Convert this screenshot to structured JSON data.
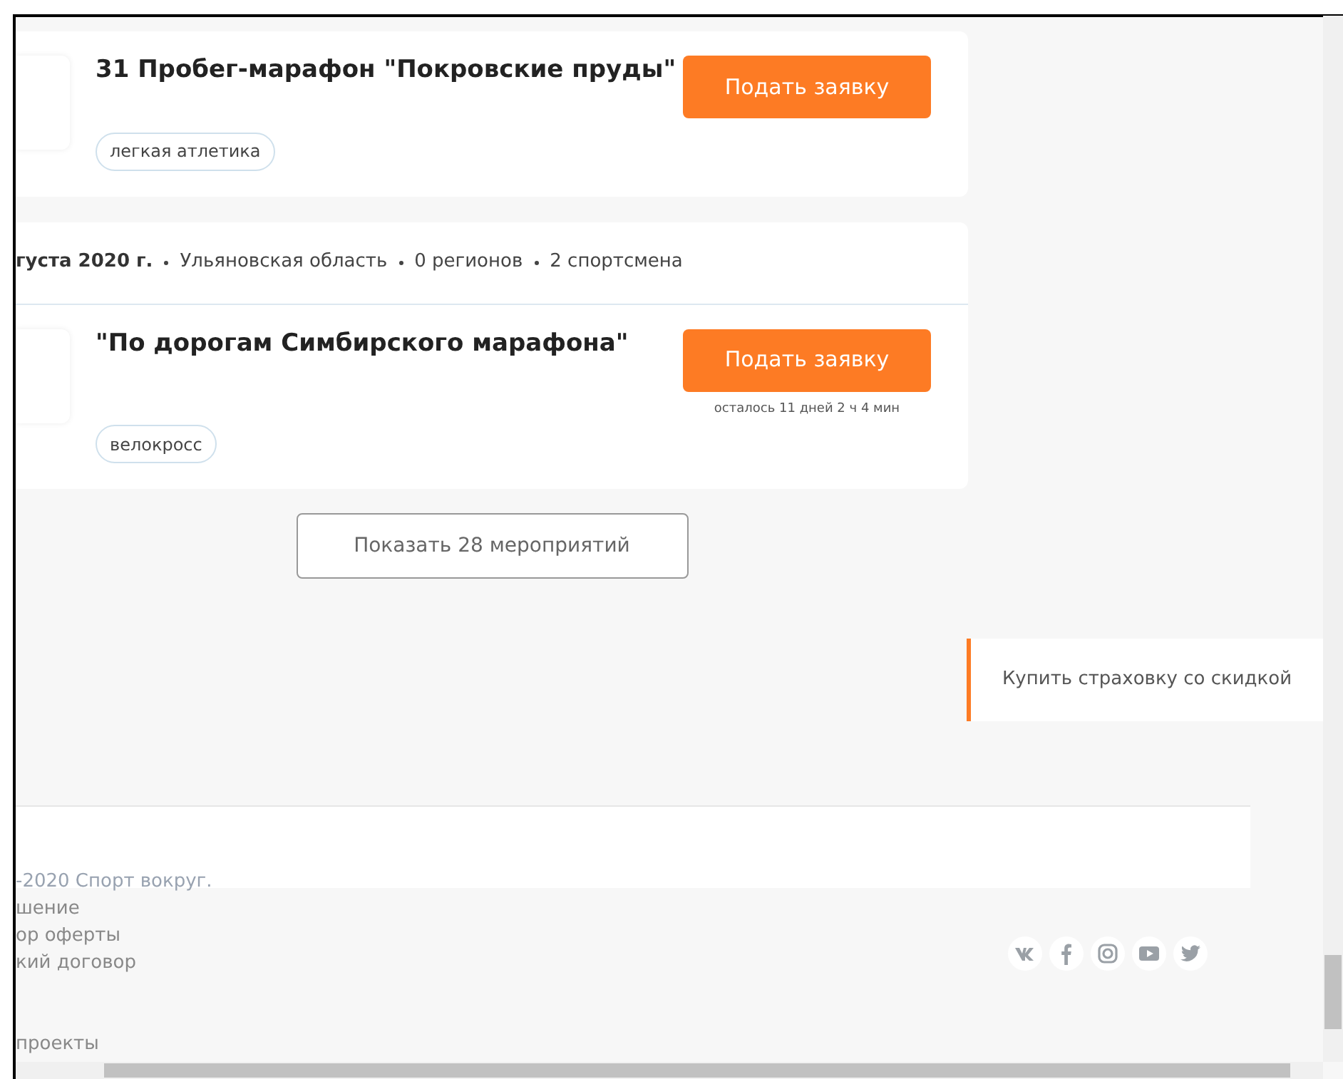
{
  "events": [
    {
      "title": "31 Пробег-марафон \"Покровские пруды\"",
      "button": "Подать заявку",
      "tags": [
        "легкая атлетика"
      ]
    },
    {
      "header": {
        "date": "густа 2020 г.",
        "details": [
          "Ульяновская область",
          "0 регионов",
          "2 спортсмена"
        ]
      },
      "title": "\"По дорогам Симбирского марафона\"",
      "button": "Подать заявку",
      "deadline": "осталось 11 дней 2 ч 4 мин",
      "tags": [
        "велокросс"
      ]
    }
  ],
  "show_more": "Показать 28 мероприятий",
  "insurance_link": "Купить страховку со скидкой",
  "footer": {
    "copyright": "-2020 Спорт вокруг.",
    "links": [
      "шение",
      "ор оферты",
      "кий договор"
    ],
    "projects": "проекты"
  }
}
